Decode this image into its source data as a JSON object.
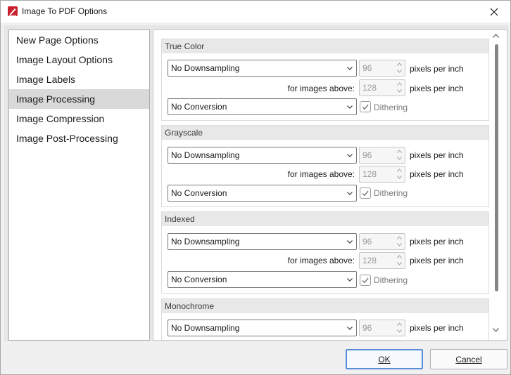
{
  "window": {
    "title": "Image To PDF Options"
  },
  "sidebar": {
    "items": [
      {
        "label": "New Page Options"
      },
      {
        "label": "Image Layout Options"
      },
      {
        "label": "Image Labels"
      },
      {
        "label": "Image Processing",
        "selected": true
      },
      {
        "label": "Image Compression"
      },
      {
        "label": "Image Post-Processing"
      }
    ]
  },
  "groups": [
    {
      "title": "True Color",
      "downsampling": "No Downsampling",
      "dpi": "96",
      "dpi_unit": "pixels per inch",
      "threshold_label": "for images above:",
      "threshold": "128",
      "threshold_unit": "pixels per inch",
      "conversion": "No Conversion",
      "dithering_label": "Dithering",
      "dithering_checked": true
    },
    {
      "title": "Grayscale",
      "downsampling": "No Downsampling",
      "dpi": "96",
      "dpi_unit": "pixels per inch",
      "threshold_label": "for images above:",
      "threshold": "128",
      "threshold_unit": "pixels per inch",
      "conversion": "No Conversion",
      "dithering_label": "Dithering",
      "dithering_checked": true
    },
    {
      "title": "Indexed",
      "downsampling": "No Downsampling",
      "dpi": "96",
      "dpi_unit": "pixels per inch",
      "threshold_label": "for images above:",
      "threshold": "128",
      "threshold_unit": "pixels per inch",
      "conversion": "No Conversion",
      "dithering_label": "Dithering",
      "dithering_checked": true
    },
    {
      "title": "Monochrome",
      "downsampling": "No Downsampling",
      "dpi": "96",
      "dpi_unit": "pixels per inch"
    }
  ],
  "buttons": {
    "ok": "OK",
    "cancel": "Cancel"
  },
  "colors": {
    "accent": "#5a8ed8",
    "app_icon": "#c8202c"
  },
  "icons": {
    "app": "pdf-pen-icon",
    "close": "close-icon",
    "dropdown": "chevron-down-icon",
    "spin_up": "chevron-up-icon",
    "spin_down": "chevron-down-icon",
    "check": "check-icon"
  }
}
